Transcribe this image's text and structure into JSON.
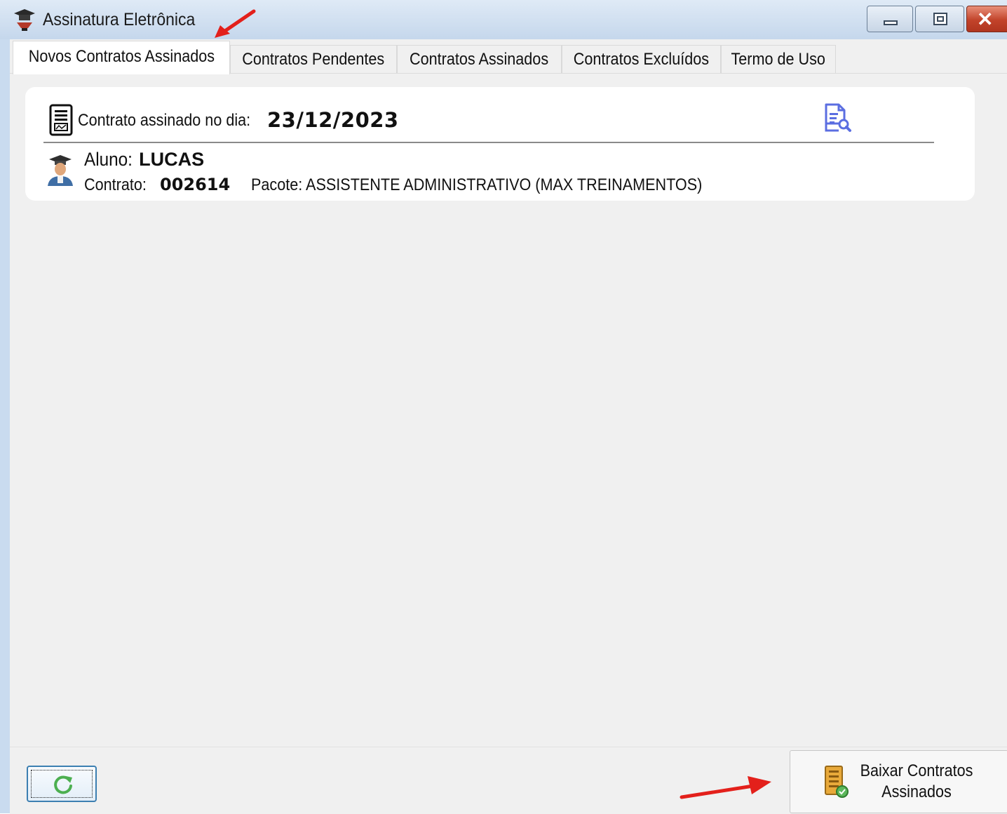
{
  "window": {
    "title": "Assinatura Eletrônica"
  },
  "tabs": [
    {
      "label": "Novos Contratos Assinados",
      "active": true
    },
    {
      "label": "Contratos Pendentes",
      "active": false
    },
    {
      "label": "Contratos Assinados",
      "active": false
    },
    {
      "label": "Contratos Excluídos",
      "active": false
    },
    {
      "label": "Termo de Uso",
      "active": false
    }
  ],
  "contract_card": {
    "signed_label": "Contrato assinado no dia:",
    "signed_date": "23/12/2023",
    "student_label": "Aluno:",
    "student_name": "LUCAS",
    "contract_label": "Contrato:",
    "contract_number": "002614",
    "package_label": "Pacote:",
    "package_value": "ASSISTENTE ADMINISTRATIVO (MAX TREINAMENTOS)"
  },
  "footer": {
    "download_label_line1": "Baixar Contratos",
    "download_label_line2": "Assinados"
  },
  "icons": {
    "app": "graduation-cap-icon",
    "contract": "contract-document-icon",
    "view": "document-search-icon",
    "student": "student-avatar-icon",
    "refresh": "refresh-icon",
    "download": "download-contracts-icon"
  },
  "colors": {
    "annotation_arrow": "#e3201b",
    "view_icon": "#5b6ee1",
    "refresh_icon": "#4caf50",
    "close_button": "#c2432a"
  }
}
